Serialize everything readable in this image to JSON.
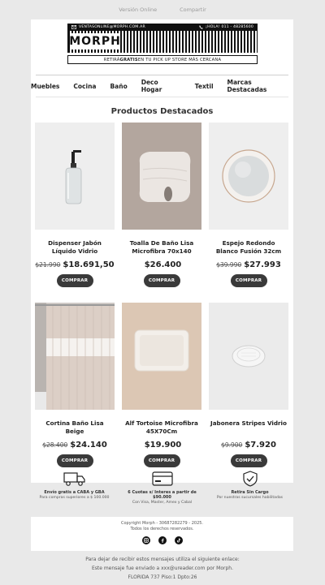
{
  "topbar": {
    "web_version": "Versión Online",
    "share": "Compartir"
  },
  "header": {
    "email": "VENTASONLINE@MORPH.COM.AR",
    "phone": "¡HOLA! 011 - 48285600",
    "logo": "MORPH",
    "pickup_pre": "RETIRÁ ",
    "pickup_bold": "GRATIS",
    "pickup_post": " EN TU PICK UP STORE MÁS CERCANA"
  },
  "nav": [
    "Muebles",
    "Cocina",
    "Baño",
    "Deco Hogar",
    "Textil",
    "Marcas Destacadas"
  ],
  "section_title": "Productos Destacados",
  "products": [
    {
      "name": "Dispenser Jabón Líquido Vidrio",
      "old_price": "$21.990",
      "price": "$18.691,50",
      "button": "COMPRAR",
      "icon": "soap-dispenser-icon"
    },
    {
      "name": "Toalla De Baño Lisa Microfibra 70x140",
      "old_price": "",
      "price": "$26.400",
      "button": "COMPRAR",
      "icon": "towel-icon"
    },
    {
      "name": "Espejo Redondo Blanco Fusión 32cm",
      "old_price": "$39.990",
      "price": "$27.993",
      "button": "COMPRAR",
      "icon": "mirror-icon"
    },
    {
      "name": "Cortina Baño Lisa Beige",
      "old_price": "$28.400",
      "price": "$24.140",
      "button": "COMPRAR",
      "icon": "shower-curtain-icon"
    },
    {
      "name": "Alf Tortoise Microfibra 45X70Cm",
      "old_price": "",
      "price": "$19.900",
      "button": "COMPRAR",
      "icon": "bath-mat-icon"
    },
    {
      "name": "Jabonera Stripes Vidrio",
      "old_price": "$9.900",
      "price": "$7.920",
      "button": "COMPRAR",
      "icon": "soap-dish-icon"
    }
  ],
  "benefits": [
    {
      "title": "Envío gratis a CABA y GBA",
      "subtitle": "Para compras superiores a $ 100.000",
      "icon": "truck-icon"
    },
    {
      "title": "6 Cuotas s/ Interes a partir de $90.000",
      "subtitle": "Con Visa, Master, Amex y Cabal",
      "icon": "credit-card-icon"
    },
    {
      "title": "Retira Sin Cargo",
      "subtitle": "Por nuestras sucursales habilitadas",
      "icon": "shield-check-icon"
    }
  ],
  "footer": {
    "copyright": "Copyright Morph - 30687282279 - 2025.",
    "rights": "Todos los derechos reservados.",
    "social": [
      "instagram-icon",
      "facebook-icon",
      "tiktok-icon"
    ]
  },
  "unsubscribe": {
    "line1": "Para dejar de recibir estos mensajes utiliza el siguiente enlace:",
    "line2": "Este mensaje fue enviado a xxx@ureader.com por Morph.",
    "line3": "FLORIDA 737 Piso:1 Dpto:26"
  },
  "colors": {
    "background": "#e9e9e9",
    "button": "#3a3a3a",
    "text": "#222222"
  }
}
